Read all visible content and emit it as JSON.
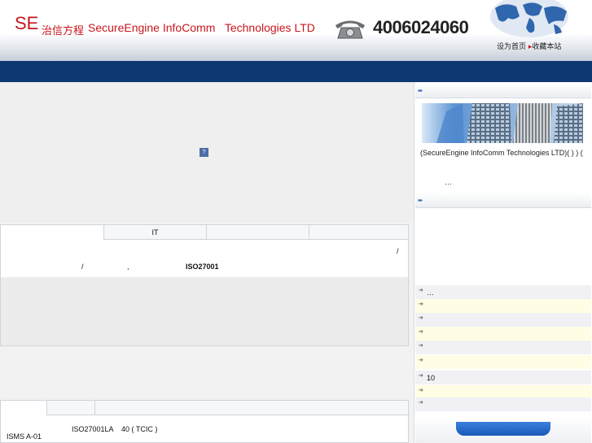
{
  "header": {
    "logo": "SE",
    "cn_name": "治信方程",
    "en_name": "SecureEngine InfoComm   Technologies LTD",
    "hotline": "4006024060",
    "links": [
      "设为首页",
      "收藏本站"
    ]
  },
  "banner": {
    "placeholder_icon": "?"
  },
  "tabs1": [
    "",
    "",
    "IT",
    "",
    ""
  ],
  "panel1": {
    "slash1": "/",
    "slash2": "/",
    "comma": ",",
    "standard": "ISO27001"
  },
  "tabs2": [
    "",
    ""
  ],
  "panel2": {
    "text": "ISO27001LA    40 ( TCIC )",
    "isms": "ISMS A-01"
  },
  "about": {
    "text": "(SecureEngine InfoComm Technologies LTD)(      )              )                   (",
    "more": "…"
  },
  "news": [
    {
      "label": "          …"
    },
    {
      "label": ""
    },
    {
      "label": ""
    },
    {
      "label": ""
    },
    {
      "label": ""
    },
    {
      "label": ""
    },
    {
      "label": "10"
    },
    {
      "label": ""
    },
    {
      "label": ""
    }
  ],
  "colors": {
    "brand_red": "#c8161d",
    "nav_blue": "#0d3872",
    "button_blue": "#1a58b8"
  }
}
